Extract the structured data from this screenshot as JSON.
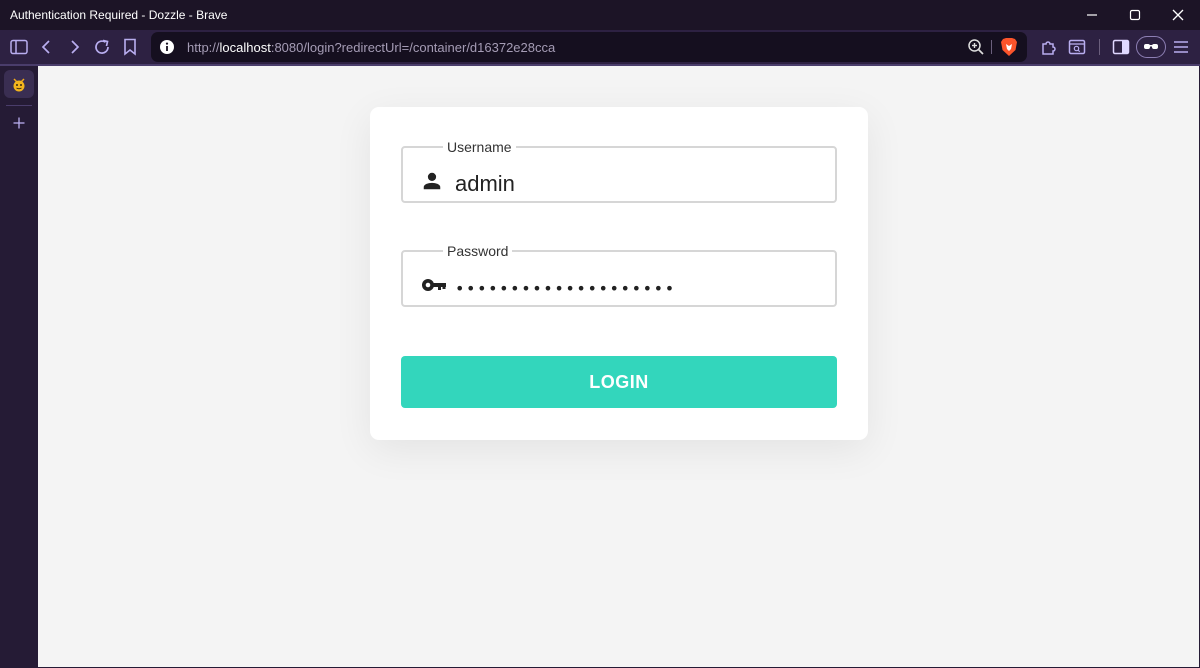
{
  "window": {
    "title": "Authentication Required - Dozzle - Brave",
    "controls": [
      "minimize-icon",
      "maximize-icon",
      "close-icon"
    ]
  },
  "toolbar": {
    "url_scheme": "http://",
    "url_host": "localhost",
    "url_rest": ":8080/login?redirectUrl=/container/d16372e28cca",
    "icons": [
      "sidebar-toggle-icon",
      "back-icon",
      "forward-icon",
      "reload-icon",
      "bookmark-icon",
      "site-info-icon",
      "zoom-icon",
      "brave-shields-icon",
      "extensions-icon",
      "leo-search-icon",
      "sidebar-panel-icon",
      "reader-mode-icon",
      "menu-icon"
    ]
  },
  "sidebar": {
    "tab_icon": "dozzle-favicon",
    "add_label": "+"
  },
  "login": {
    "username_label": "Username",
    "username_value": "admin",
    "password_label": "Password",
    "password_value": "••••••••••••••••••••",
    "submit_label": "LOGIN"
  },
  "colors": {
    "accent": "#33d6bc",
    "titlebar": "#1c1426",
    "toolbar": "#2d2142",
    "content_bg": "#f4f4f4"
  }
}
